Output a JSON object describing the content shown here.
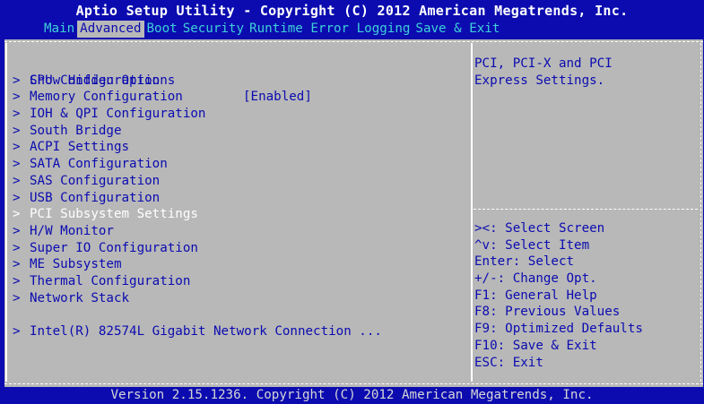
{
  "title": "Aptio Setup Utility - Copyright (C) 2012 American Megatrends, Inc.",
  "menu": [
    {
      "label": "Main",
      "active": false
    },
    {
      "label": "Advanced",
      "active": true
    },
    {
      "label": "Boot",
      "active": false
    },
    {
      "label": "Security",
      "active": false
    },
    {
      "label": "Runtime Error Logging",
      "active": false
    },
    {
      "label": "Save & Exit",
      "active": false
    }
  ],
  "options": {
    "hidden": {
      "label": "Show Hidden Options",
      "value": "[Enabled]"
    },
    "items": [
      {
        "arrow": ">",
        "label": "CPU Configuration"
      },
      {
        "arrow": ">",
        "label": "Memory Configuration"
      },
      {
        "arrow": ">",
        "label": "IOH & QPI Configuration"
      },
      {
        "arrow": ">",
        "label": "South Bridge"
      },
      {
        "arrow": ">",
        "label": "ACPI Settings"
      },
      {
        "arrow": ">",
        "label": "SATA Configuration"
      },
      {
        "arrow": ">",
        "label": "SAS Configuration"
      },
      {
        "arrow": ">",
        "label": "USB Configuration"
      },
      {
        "arrow": ">",
        "label": "PCI Subsystem Settings"
      },
      {
        "arrow": ">",
        "label": "H/W Monitor"
      },
      {
        "arrow": ">",
        "label": "Super IO Configuration"
      },
      {
        "arrow": ">",
        "label": "ME Subsystem"
      },
      {
        "arrow": ">",
        "label": "Thermal Configuration"
      },
      {
        "arrow": ">",
        "label": "Network Stack"
      },
      {
        "arrow": ">",
        "label": "Intel(R) 82574L Gigabit Network Connection ..."
      }
    ],
    "selected_index": 8
  },
  "help": {
    "line1": "PCI, PCI-X and PCI",
    "line2": "Express Settings."
  },
  "keys": [
    "><: Select Screen",
    "^v: Select Item",
    "Enter: Select",
    "+/-: Change Opt.",
    "F1: General Help",
    "F8: Previous Values",
    "F9: Optimized Defaults",
    "F10: Save & Exit",
    "ESC: Exit"
  ],
  "footer": "Version 2.15.1236. Copyright (C) 2012 American Megatrends, Inc.",
  "colors": {
    "background": "#0b0bb0",
    "panel": "#b8b8b8",
    "menu_text": "#3fd0d8",
    "highlight_text": "#ffffff"
  }
}
